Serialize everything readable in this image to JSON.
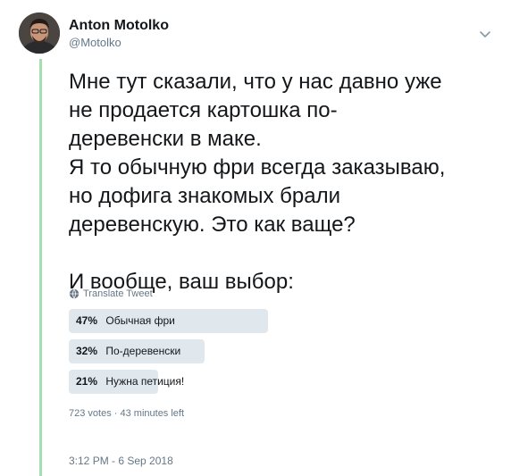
{
  "author": {
    "name": "Anton Motolko",
    "handle": "@Motolko"
  },
  "tweet": {
    "text": "Мне тут сказали, что у нас давно уже\nне продается картошка по-\nдеревенски в маке.\nЯ то обычную фри всегда заказываю,\nно дофига знакомых брали\nдеревенскую. Это как ваще?\n\nИ вообще, ваш выбор:",
    "translate_label": "Translate Tweet"
  },
  "poll": {
    "options": [
      {
        "percent": 47,
        "percent_label": "47%",
        "label": "Обычная фри"
      },
      {
        "percent": 32,
        "percent_label": "32%",
        "label": "По-деревенски"
      },
      {
        "percent": 21,
        "percent_label": "21%",
        "label": "Нужна петиция!"
      }
    ],
    "votes": "723 votes",
    "separator": "·",
    "time_left": "43 minutes left"
  },
  "timestamp": "3:12 PM - 6 Sep 2018",
  "colors": {
    "thread_line": "#a5dfb0",
    "poll_fill": "#e1e8ed",
    "secondary_text": "#657786",
    "primary_text": "#14171a"
  },
  "icons": {
    "menu": "chevron-down-icon",
    "translate": "globe-icon"
  }
}
